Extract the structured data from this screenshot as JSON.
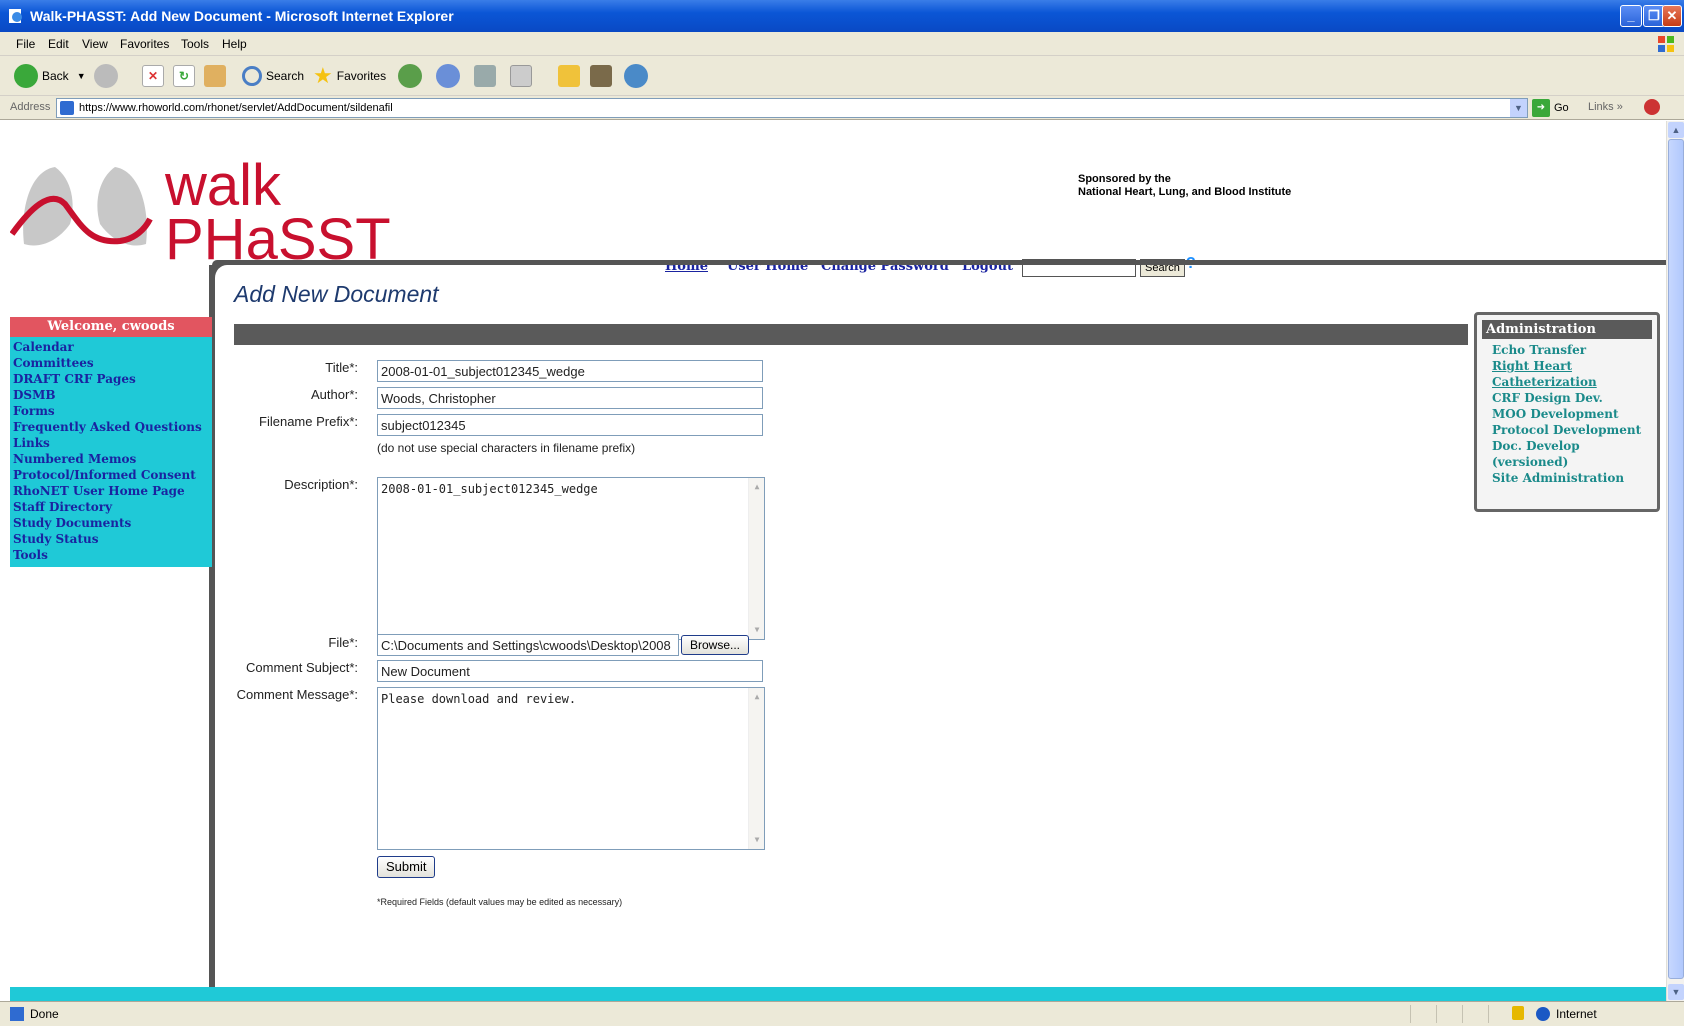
{
  "window": {
    "title": "Walk-PHASST: Add New Document - Microsoft Internet Explorer"
  },
  "menu": [
    "File",
    "Edit",
    "View",
    "Favorites",
    "Tools",
    "Help"
  ],
  "toolbar": {
    "back": "Back",
    "search": "Search",
    "favorites": "Favorites"
  },
  "address": {
    "label": "Address",
    "url": "https://www.rhoworld.com/rhonet/servlet/AddDocument/sildenafil",
    "go": "Go",
    "links": "Links"
  },
  "logo": {
    "line1": "walk",
    "line2": "PHaSST"
  },
  "sponsor": {
    "line1": "Sponsored by the",
    "line2": "National Heart, Lung, and Blood Institute"
  },
  "topnav": {
    "home": "Home",
    "user_home": "User Home",
    "change_password": "Change Password",
    "logout": "Logout",
    "search_button": "Search",
    "help": "?"
  },
  "sidebar": {
    "welcome": "Welcome, cwoods",
    "items": [
      "Calendar",
      "Committees",
      "DRAFT CRF Pages",
      "DSMB",
      "Forms",
      "Frequently Asked Questions",
      "Links",
      "Numbered Memos",
      "Protocol/Informed Consent",
      "RhoNET User Home Page",
      "Staff Directory",
      "Study Documents",
      "Study Status",
      "Tools"
    ]
  },
  "form": {
    "page_title": "Add New Document",
    "title_label": "Title*:",
    "title_value": "2008-01-01_subject012345_wedge",
    "author_label": "Author*:",
    "author_value": "Woods, Christopher",
    "prefix_label": "Filename Prefix*:",
    "prefix_value": "subject012345",
    "prefix_hint": "(do not use special characters in filename prefix)",
    "description_label": "Description*:",
    "description_value": "2008-01-01_subject012345_wedge",
    "file_label": "File*:",
    "file_value": "C:\\Documents and Settings\\cwoods\\Desktop\\2008",
    "browse_label": "Browse...",
    "comment_subject_label": "Comment Subject*:",
    "comment_subject_value": "New Document",
    "comment_message_label": "Comment Message*:",
    "comment_message_value": "Please download and review.",
    "submit_label": "Submit",
    "required_note": "*Required Fields (default values may be edited as necessary)"
  },
  "admin": {
    "header": "Administration",
    "items": [
      "Echo Transfer",
      "Right Heart",
      "Catheterization",
      "CRF Design Dev.",
      "MOO Development",
      "Protocol Development",
      "Doc. Develop",
      "(versioned)",
      "Site Administration"
    ]
  },
  "status": {
    "text": "Done",
    "zone": "Internet"
  },
  "colors": {
    "accent_red": "#c8102e",
    "sidebar_cyan": "#1fc9d7",
    "nav_blue": "#1a23a0",
    "admin_teal": "#1a8a8a"
  }
}
